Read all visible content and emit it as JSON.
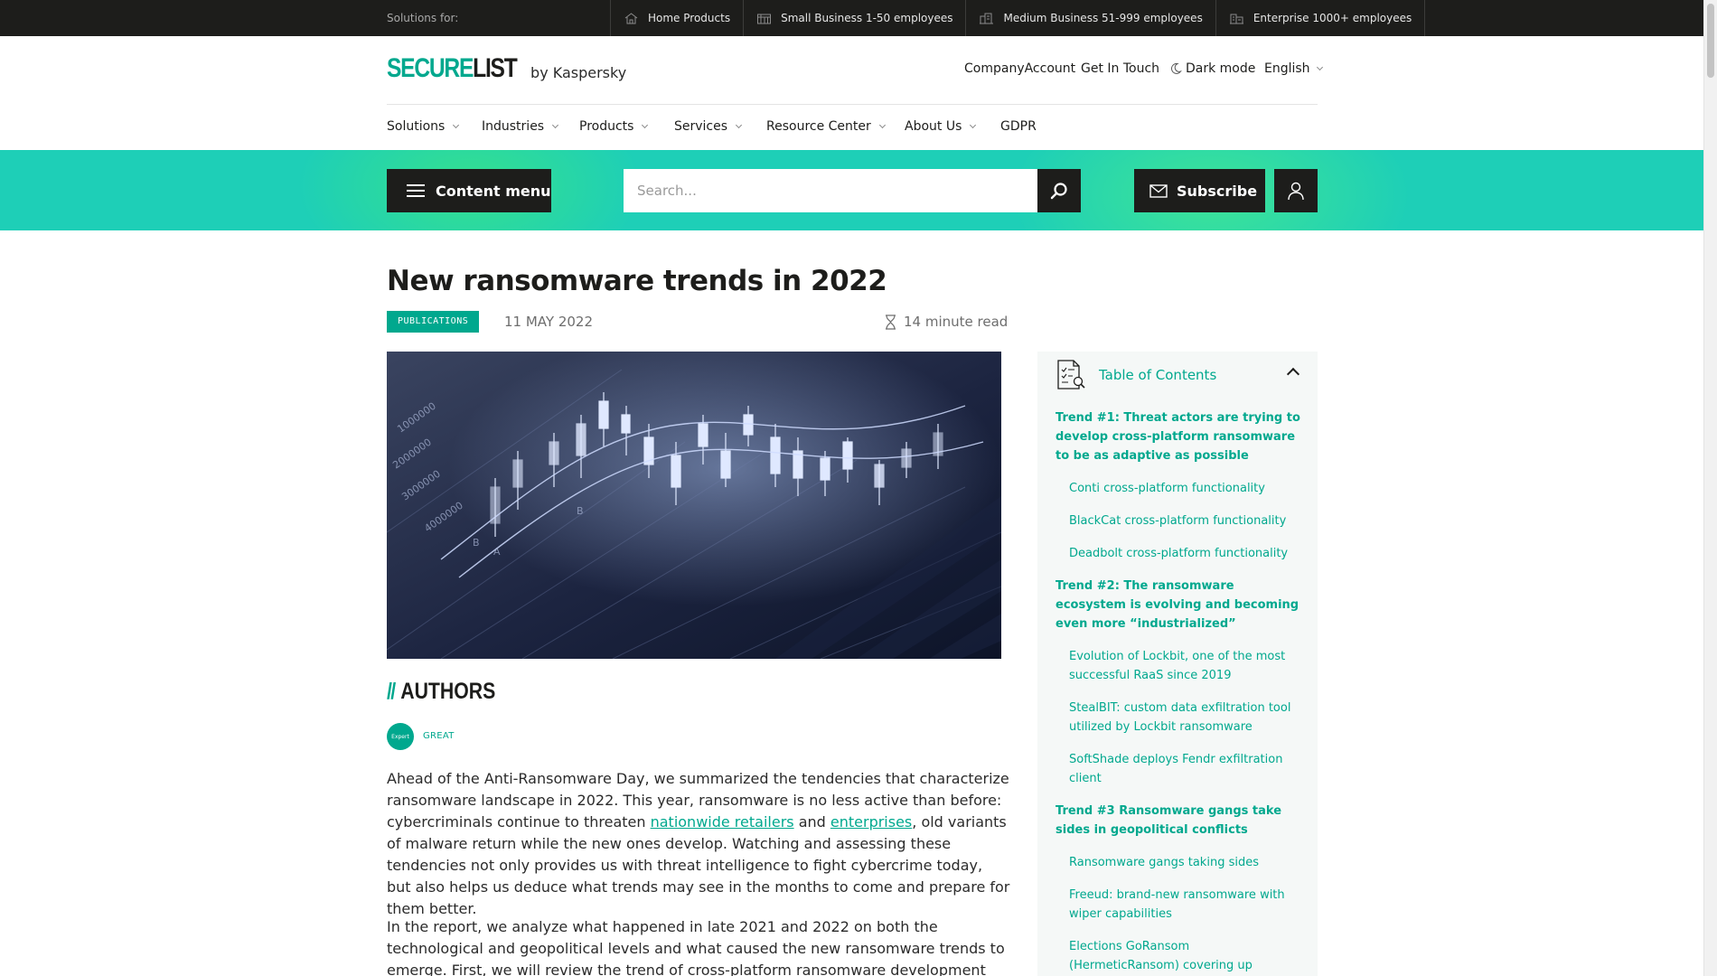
{
  "topbar": {
    "label": "Solutions for:",
    "segments": [
      {
        "label": "Home Products",
        "icon": "home-icon"
      },
      {
        "label": "Small Business 1-50 employees",
        "icon": "small-business-icon"
      },
      {
        "label": "Medium Business 51-999 employees",
        "icon": "medium-business-icon"
      },
      {
        "label": "Enterprise 1000+ employees",
        "icon": "enterprise-icon"
      }
    ]
  },
  "header": {
    "brand_green": "SECURE",
    "brand_dark": "LIST",
    "brand_suffix": "by Kaspersky",
    "links": {
      "company_account": "CompanyAccount",
      "get_in_touch": "Get In Touch",
      "dark_mode": "Dark mode",
      "language": "English"
    }
  },
  "nav": [
    "Solutions",
    "Industries",
    "Products",
    "Services",
    "Resource Center",
    "About Us",
    "GDPR"
  ],
  "banner": {
    "content_menu": "Content menu",
    "search_placeholder": "Search...",
    "subscribe": "Subscribe"
  },
  "article": {
    "title": "New ransomware trends in 2022",
    "category": "PUBLICATIONS",
    "date": "11 MAY 2022",
    "read_time": "14 minute read",
    "authors_heading": "AUTHORS",
    "avatar_text": "Expert",
    "author": "GREAT",
    "p1_a": "Ahead of the Anti-Ransomware Day, we summarized the tendencies that characterize ransomware landscape in 2022. This year, ransomware is no less active than before: cybercriminals continue to threaten ",
    "p1_link1": "nationwide retailers",
    "p1_b": " and ",
    "p1_link2": "enterprises",
    "p1_c": ", old variants of malware return while the new ones develop. Watching and assessing these tendencies not only provides us with threat intelligence to fight cybercrime today, but also helps us deduce what trends may see in the months to come and prepare for them better.",
    "p2": "In the report, we analyze what happened in late 2021 and 2022 on both the technological and geopolitical levels and what caused the new ransomware trends to emerge. First, we will review the trend of cross-platform ransomware development that is becoming more and more"
  },
  "toc": {
    "title": "Table of Contents",
    "items": [
      {
        "level": "main",
        "label": "Trend #1: Threat actors are trying to develop cross-platform ransomware to be as adaptive as possible"
      },
      {
        "level": "sub",
        "label": "Conti cross-platform functionality"
      },
      {
        "level": "sub",
        "label": "BlackCat cross-platform functionality"
      },
      {
        "level": "sub",
        "label": "Deadbolt cross-platform functionality"
      },
      {
        "level": "main",
        "label": "Trend #2: The ransomware ecosystem is evolving and becoming even more “industrialized”"
      },
      {
        "level": "sub",
        "label": "Evolution of Lockbit, one of the most successful RaaS since 2019"
      },
      {
        "level": "sub",
        "label": "StealBIT: custom data exfiltration tool utilized by Lockbit ransomware"
      },
      {
        "level": "sub",
        "label": "SoftShade deploys Fendr exfiltration client"
      },
      {
        "level": "main",
        "label": "Trend #3 Ransomware gangs take sides in geopolitical conflicts"
      },
      {
        "level": "sub",
        "label": "Ransomware gangs taking sides"
      },
      {
        "level": "sub",
        "label": "Freeud: brand-new ransomware with wiper capabilities"
      },
      {
        "level": "sub",
        "label": "Elections GoRansom (HermeticRansom) covering up destructive activity"
      }
    ]
  },
  "colors": {
    "accent": "#00a88e",
    "banner": "#1ecfb7",
    "dark": "#1d1d1b"
  }
}
